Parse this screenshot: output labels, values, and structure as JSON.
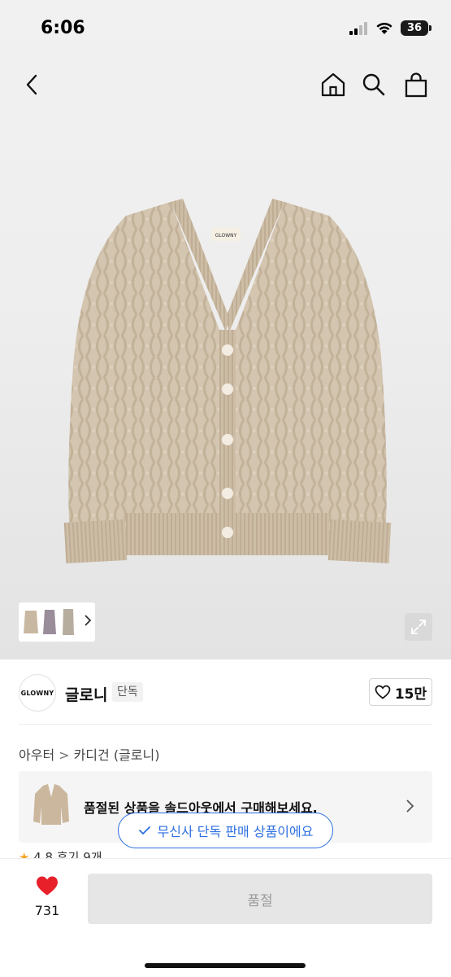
{
  "status_bar": {
    "time": "6:06",
    "battery": "36"
  },
  "nav": {
    "back_icon": "chevron-left-icon",
    "home_icon": "home-icon",
    "search_icon": "search-icon",
    "cart_icon": "shopping-bag-icon"
  },
  "product": {
    "image_label": "GLOWNY"
  },
  "brand": {
    "logo_text": "GLOWNY",
    "name": "글로니",
    "badge": "단독",
    "like_count": "15만"
  },
  "breadcrumb": {
    "category": "아우터",
    "separator": ">",
    "subcategory": "카디건 (글로니)"
  },
  "soldout_banner": {
    "text": "품절된 상품을 솔드아웃에서 구매해보세요."
  },
  "exclusive_toast": {
    "text": "무신사 단독 판매 상품이에요"
  },
  "rating_peek": {
    "star": "★",
    "score": "4.8",
    "reviews": "후기 9개"
  },
  "bottom_bar": {
    "heart_count": "731",
    "buy_label": "품절"
  },
  "colors": {
    "accent_blue": "#2d6fe0",
    "heart_red": "#e8202a",
    "sweater": "#d2c2ad"
  }
}
